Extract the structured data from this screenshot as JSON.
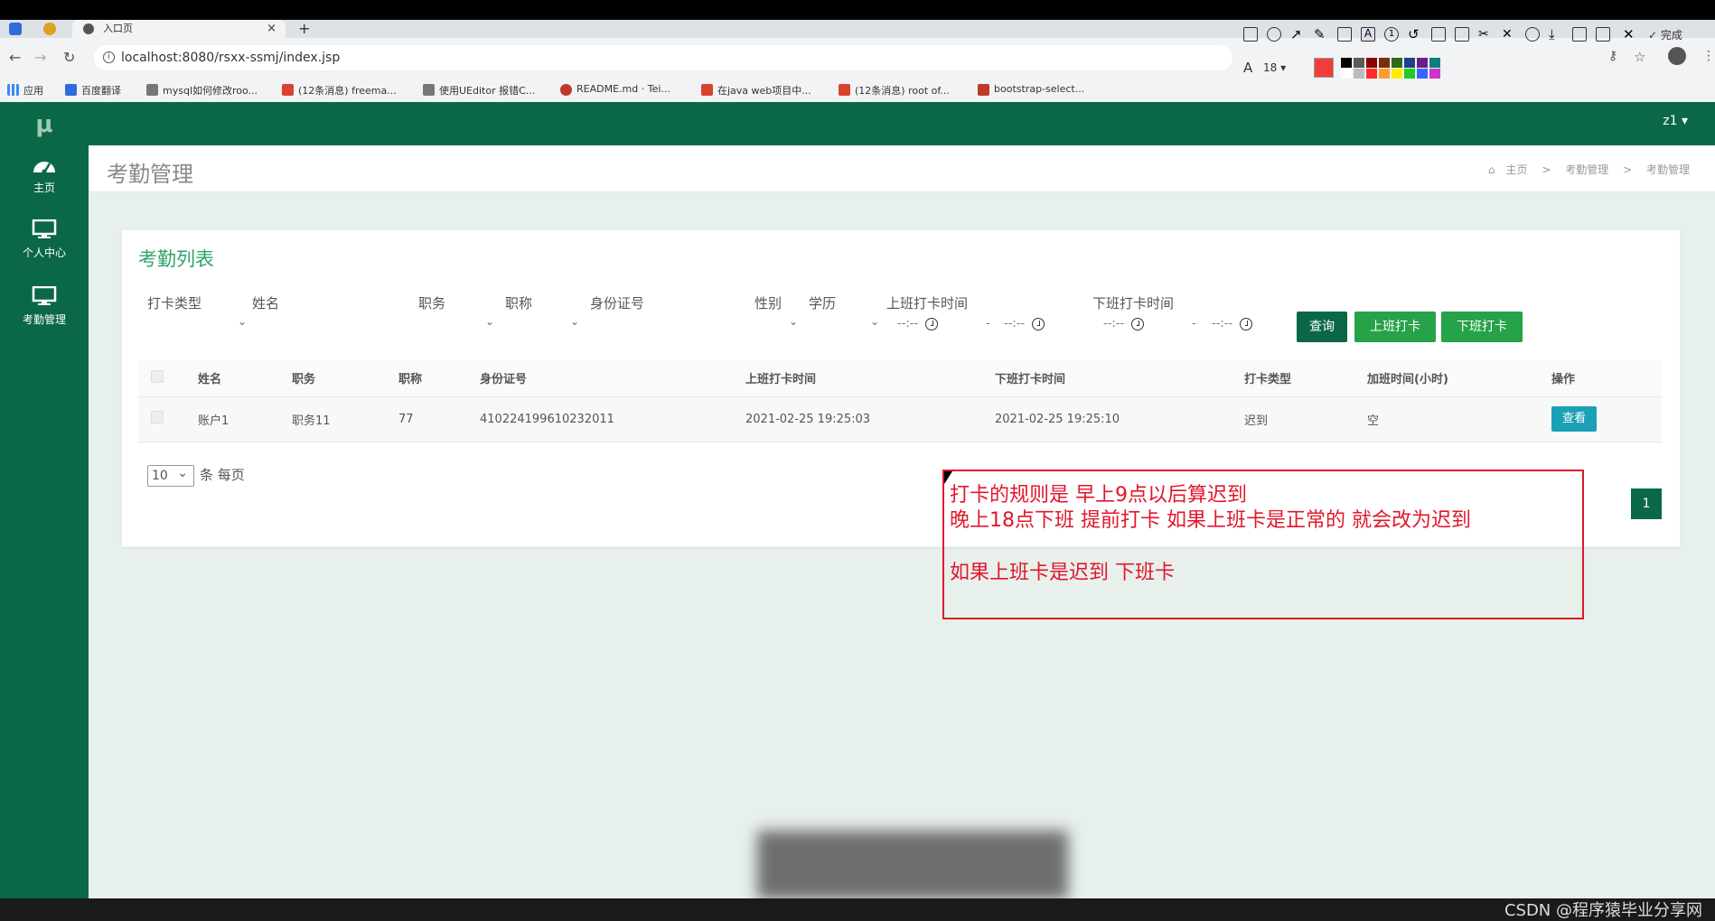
{
  "browser": {
    "tab_title": "入口页",
    "new_tab": "+",
    "url": "localhost:8080/rsxx-ssmj/index.jsp",
    "bookmarks": [
      {
        "label": "应用",
        "color": "#555555"
      },
      {
        "label": "百度翻译",
        "color": "#2f6bd9"
      },
      {
        "label": "mysql如何修改roo...",
        "color": "#777777"
      },
      {
        "label": "(12条消息) freema...",
        "color": "#d9422f"
      },
      {
        "label": "使用UEditor 报错C...",
        "color": "#777777"
      },
      {
        "label": "README.md · Tei...",
        "color": "#c0392b"
      },
      {
        "label": "在java web项目中...",
        "color": "#d9422f"
      },
      {
        "label": "(12条消息) root of...",
        "color": "#d9422f"
      },
      {
        "label": "bootstrap-select...",
        "color": "#c0392b"
      }
    ]
  },
  "annotation_toolbar": {
    "font_size": "18",
    "done_label": "完成",
    "active_color": "#f23c3c",
    "swatches": [
      "#000000",
      "#5a5a5a",
      "#8b0000",
      "#7a2e0e",
      "#2e6b1f",
      "#1e3f8a",
      "#6b1e8a",
      "#107e7e",
      "#ffffff",
      "#bbbbbb",
      "#ff2a2a",
      "#ff9933",
      "#ffee00",
      "#22cc22",
      "#3366ff",
      "#cc33cc"
    ]
  },
  "sidebar": {
    "logo": "μ",
    "items": [
      {
        "label": "主页",
        "icon": "dashboard-icon"
      },
      {
        "label": "个人中心",
        "icon": "monitor-icon"
      },
      {
        "label": "考勤管理",
        "icon": "monitor-icon"
      }
    ]
  },
  "topbar": {
    "user": "z1 ▾"
  },
  "header": {
    "title": "考勤管理",
    "breadcrumb": [
      "主页",
      "考勤管理",
      "考勤管理"
    ]
  },
  "card": {
    "title": "考勤列表",
    "filters": {
      "punch_type": "打卡类型",
      "name": "姓名",
      "position": "职务",
      "title": "职称",
      "id_number": "身份证号",
      "gender": "性别",
      "education": "学历",
      "clock_in_time": "上班打卡时间",
      "clock_out_time": "下班打卡时间",
      "time_placeholder": "--:--",
      "range_sep": "-"
    },
    "buttons": {
      "query": "查询",
      "clock_in": "上班打卡",
      "clock_out": "下班打卡"
    },
    "table": {
      "headers": [
        "姓名",
        "职务",
        "职称",
        "身份证号",
        "上班打卡时间",
        "下班打卡时间",
        "打卡类型",
        "加班时间(小时)",
        "操作"
      ],
      "rows": [
        [
          "账户1",
          "职务11",
          "77",
          "410224199610232011",
          "2021-02-25 19:25:03",
          "2021-02-25 19:25:10",
          "迟到",
          "空"
        ]
      ],
      "view_label": "查看"
    },
    "page_size": "10",
    "page_size_suffix": "条 每页",
    "current_page": "1"
  },
  "annotation": {
    "lines": [
      "打卡的规则是  早上9点以后算迟到",
      "晚上18点下班  提前打卡  如果上班卡是正常的 就会改为迟到",
      "如果上班卡是迟到 下班卡"
    ]
  },
  "watermark": "CSDN @程序猿毕业分享网"
}
